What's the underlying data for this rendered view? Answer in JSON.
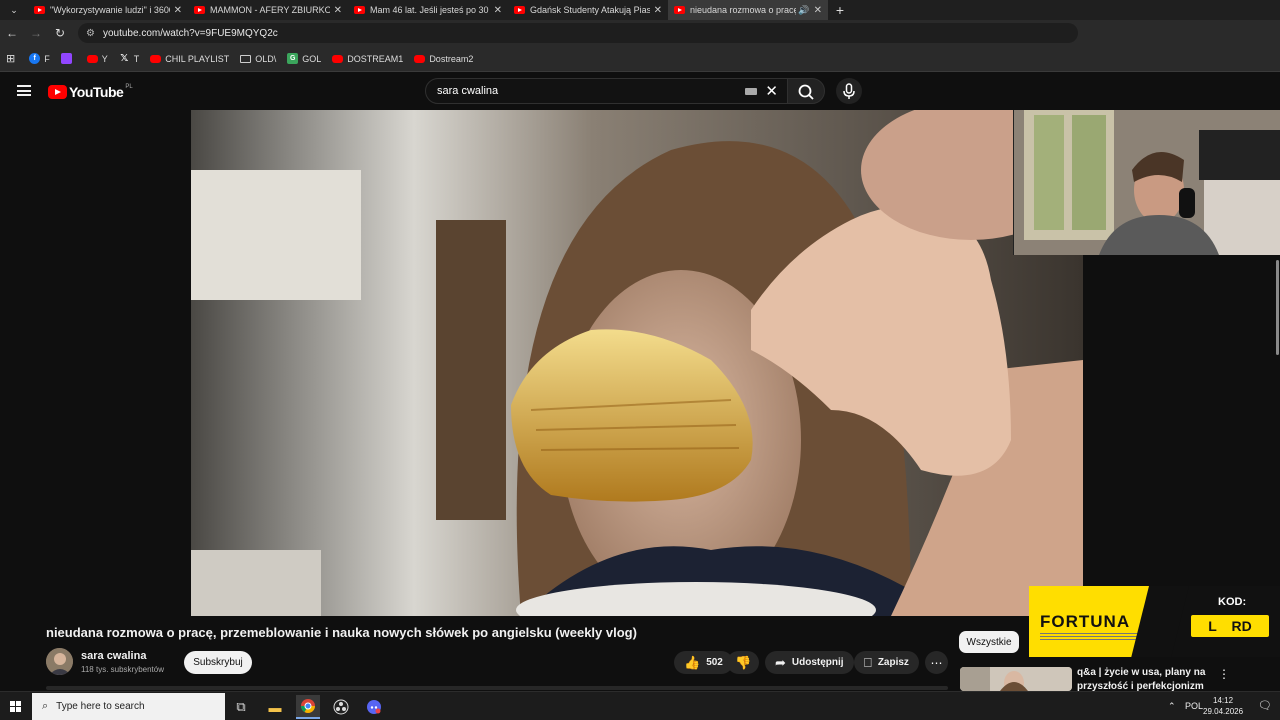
{
  "browser": {
    "tabs": [
      {
        "title": "\"Wykorzystywanie ludzi\" i 3600",
        "active": false,
        "speaker": false
      },
      {
        "title": "MAMMON - AFERY ZBIURKOW",
        "active": false,
        "speaker": false
      },
      {
        "title": "Mam 46 lat. Jeśli jesteś po 30 c",
        "active": false,
        "speaker": false
      },
      {
        "title": "Gdańsk Studenty Atakują Piasto",
        "active": false,
        "speaker": false
      },
      {
        "title": "nieudana rozmowa o pracę",
        "active": true,
        "speaker": true
      }
    ],
    "url": "youtube.com/watch?v=9FUE9MQYQ2c",
    "bookmarks": [
      {
        "label": "F",
        "icon": "facebook-icon"
      },
      {
        "label": "",
        "icon": "twitch-icon"
      },
      {
        "label": "Y",
        "icon": "youtube-icon"
      },
      {
        "label": "T",
        "icon": "x-icon"
      },
      {
        "label": "CHIL PLAYLIST",
        "icon": "youtube-icon"
      },
      {
        "label": "OLD\\",
        "icon": "folder-icon"
      },
      {
        "label": "GOL",
        "icon": "game-icon"
      },
      {
        "label": "DOSTREAM1",
        "icon": "youtube-icon"
      },
      {
        "label": "Dostream2",
        "icon": "youtube-icon"
      }
    ]
  },
  "youtube": {
    "logo": "YouTube",
    "country": "PL",
    "search_query": "sara cwalina"
  },
  "video": {
    "title": "nieudana rozmowa o pracę, przemeblowanie i nauka nowych słówek po angielsku (weekly vlog)",
    "channel": "sara cwalina",
    "subscribers": "118 tys. subskrybentów",
    "subscribe_label": "Subskrybuj",
    "likes": "502",
    "share_label": "Udostępnij",
    "save_label": "Zapisz"
  },
  "sidebar": {
    "chip_label": "Wszystkie",
    "recommended": [
      {
        "title": "q&a | życie w usa, plany na przyszłość i perfekcjonizm ..."
      }
    ]
  },
  "ad": {
    "brand": "FORTUNA",
    "code_label": "KOD:",
    "code_chars": [
      "L",
      "RD"
    ]
  },
  "taskbar": {
    "search_placeholder": "Type here to search",
    "language": "POL",
    "time": "14:12",
    "date": "29.04.2026"
  },
  "colors": {
    "youtube_red": "#ff0000",
    "fortuna_yellow": "#ffde00",
    "background": "#0f0f0f"
  }
}
